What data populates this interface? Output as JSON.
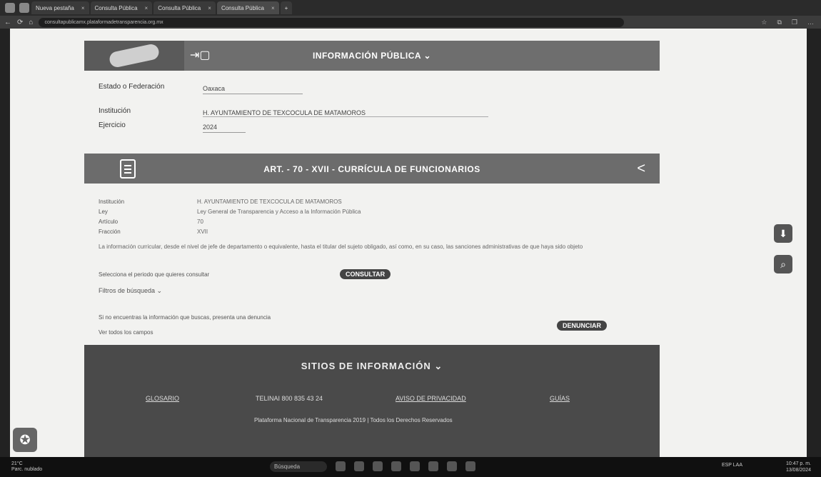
{
  "browser": {
    "tabs": [
      {
        "label": "Nueva pestaña",
        "active": false
      },
      {
        "label": "Consulta Pública",
        "active": false
      },
      {
        "label": "Consulta Pública",
        "active": false
      },
      {
        "label": "Consulta Pública",
        "active": true
      }
    ],
    "url": "consultapublicamx.plataformadetransparencia.org.mx"
  },
  "header": {
    "title": "INFORMACIÓN PÚBLICA ⌄"
  },
  "filters": {
    "estado_label": "Estado o Federación",
    "estado_value": "Oaxaca",
    "institucion_label": "Institución",
    "institucion_value": "H. AYUNTAMIENTO DE TEXCOCULA DE MATAMOROS",
    "ejercicio_label": "Ejercicio",
    "ejercicio_value": "2024"
  },
  "section": {
    "title": "ART. - 70 - XVII - CURRÍCULA DE FUNCIONARIOS"
  },
  "details": {
    "rows": [
      {
        "label": "Institución",
        "value": "H. AYUNTAMIENTO DE TEXCOCULA DE MATAMOROS"
      },
      {
        "label": "Ley",
        "value": "Ley General de Transparencia y Acceso a la Información Pública"
      },
      {
        "label": "Artículo",
        "value": "70"
      },
      {
        "label": "Fracción",
        "value": "XVII"
      }
    ],
    "description": "La información curricular, desde el nivel de jefe de departamento o equivalente, hasta el titular del sujeto obligado, así como, en su caso, las sanciones administrativas de que haya sido objeto",
    "consult_prompt": "Selecciona el periodo que quieres consultar",
    "consult_button": "CONSULTAR",
    "filters_toggle": "Filtros de búsqueda ⌄",
    "report_prompt": "Si no encuentras la información que buscas, presenta una denuncia",
    "report_button": "DENUNCIAR",
    "all_fields": "Ver todos los campos"
  },
  "footer": {
    "title": "SITIOS DE INFORMACIÓN ⌄",
    "links": [
      "GLOSARIO",
      "TELINAI 800 835 43 24",
      "AVISO DE PRIVACIDAD",
      "GUÍAS"
    ],
    "copyright": "Plataforma Nacional de Transparencia 2019 | Todos los Derechos Reservados"
  },
  "taskbar": {
    "weather_temp": "21°C",
    "weather_desc": "Parc. nublado",
    "search_label": "Búsqueda",
    "time": "10:47 p. m.",
    "date": "13/08/2024",
    "lang": "ESP LAA"
  }
}
